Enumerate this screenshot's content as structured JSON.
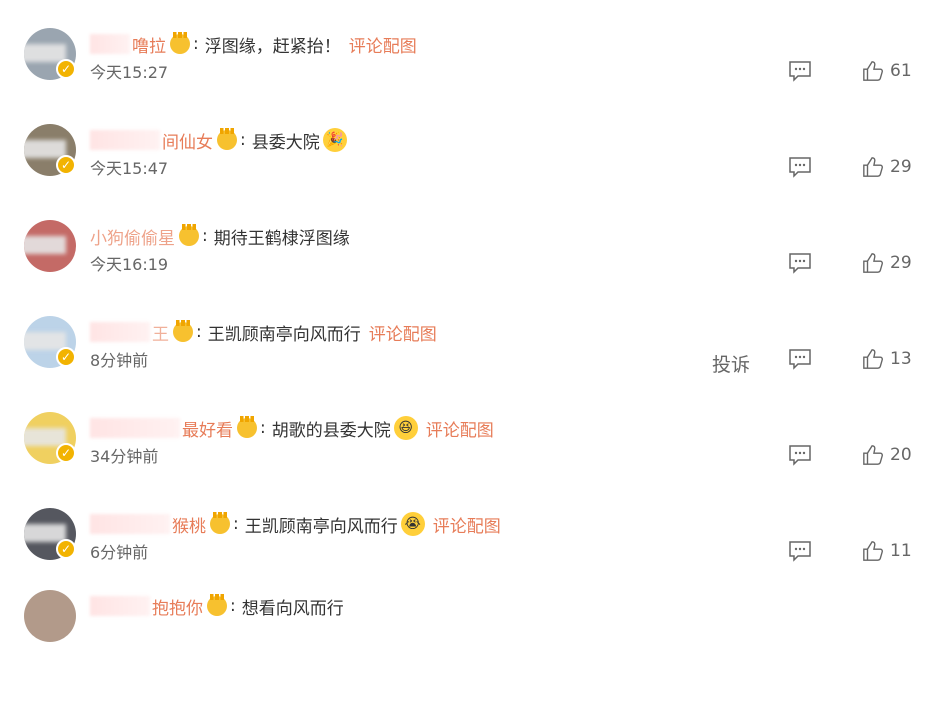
{
  "comments": [
    {
      "name_visible": "噜拉",
      "text": "浮图缘，赶紧抬！",
      "link": "评论配图",
      "time": "今天15:27",
      "likes": "61",
      "avatar_color": "#9aa5b0",
      "emoji": ""
    },
    {
      "name_visible": "间仙女",
      "text": "县委大院",
      "link": "",
      "time": "今天15:47",
      "likes": "29",
      "avatar_color": "#8a7e6a",
      "emoji": "celebrate-emoji"
    },
    {
      "name_visible": "小狗偷偷星",
      "text": "期待王鹤棣浮图缘",
      "link": "",
      "time": "今天16:19",
      "likes": "29",
      "avatar_color": "#c46a66",
      "emoji": ""
    },
    {
      "name_visible": "王",
      "text": "王凯顾南亭向风而行",
      "link": "评论配图",
      "time": "8分钟前",
      "likes": "13",
      "avatar_color": "#bcd3e8",
      "emoji": "",
      "report": "投诉"
    },
    {
      "name_visible": "最好看",
      "text": "胡歌的县委大院",
      "link": "评论配图",
      "time": "34分钟前",
      "likes": "20",
      "avatar_color": "#f0d060",
      "emoji": "cheer-emoji"
    },
    {
      "name_visible": "猴桃",
      "text": "王凯顾南亭向风而行",
      "link": "评论配图",
      "time": "6分钟前",
      "likes": "11",
      "avatar_color": "#55575f",
      "emoji": "tears-emoji"
    },
    {
      "name_visible": "抱抱你",
      "text": "想看向风而行",
      "link": "",
      "time": "",
      "likes": "",
      "avatar_color": "#b29a8a",
      "emoji": ""
    }
  ]
}
